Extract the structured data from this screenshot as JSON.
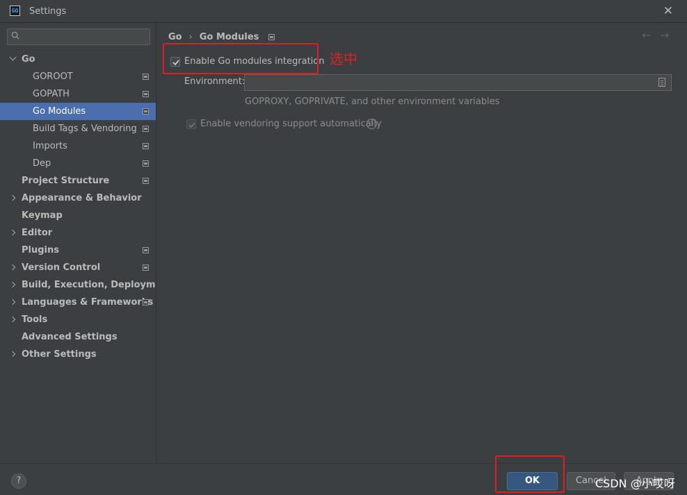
{
  "window": {
    "title": "Settings",
    "app_icon_text": "GO"
  },
  "search": {
    "placeholder": ""
  },
  "sidebar": {
    "items": [
      {
        "label": "Go",
        "level": 0,
        "expander": "down",
        "bold": true,
        "proj_icon": false,
        "selected": false
      },
      {
        "label": "GOROOT",
        "level": 1,
        "expander": "none",
        "bold": false,
        "proj_icon": true,
        "selected": false
      },
      {
        "label": "GOPATH",
        "level": 1,
        "expander": "none",
        "bold": false,
        "proj_icon": true,
        "selected": false
      },
      {
        "label": "Go Modules",
        "level": 1,
        "expander": "none",
        "bold": false,
        "proj_icon": true,
        "selected": true
      },
      {
        "label": "Build Tags & Vendoring",
        "level": 1,
        "expander": "none",
        "bold": false,
        "proj_icon": true,
        "selected": false
      },
      {
        "label": "Imports",
        "level": 1,
        "expander": "none",
        "bold": false,
        "proj_icon": true,
        "selected": false
      },
      {
        "label": "Dep",
        "level": 1,
        "expander": "none",
        "bold": false,
        "proj_icon": true,
        "selected": false
      },
      {
        "label": "Project Structure",
        "level": 0,
        "expander": "none",
        "bold": true,
        "proj_icon": true,
        "selected": false
      },
      {
        "label": "Appearance & Behavior",
        "level": 0,
        "expander": "right",
        "bold": true,
        "proj_icon": false,
        "selected": false
      },
      {
        "label": "Keymap",
        "level": 0,
        "expander": "none",
        "bold": true,
        "proj_icon": false,
        "selected": false
      },
      {
        "label": "Editor",
        "level": 0,
        "expander": "right",
        "bold": true,
        "proj_icon": false,
        "selected": false
      },
      {
        "label": "Plugins",
        "level": 0,
        "expander": "none",
        "bold": true,
        "proj_icon": true,
        "selected": false
      },
      {
        "label": "Version Control",
        "level": 0,
        "expander": "right",
        "bold": true,
        "proj_icon": true,
        "selected": false
      },
      {
        "label": "Build, Execution, Deployment",
        "level": 0,
        "expander": "right",
        "bold": true,
        "proj_icon": false,
        "selected": false
      },
      {
        "label": "Languages & Frameworks",
        "level": 0,
        "expander": "right",
        "bold": true,
        "proj_icon": true,
        "selected": false
      },
      {
        "label": "Tools",
        "level": 0,
        "expander": "right",
        "bold": true,
        "proj_icon": false,
        "selected": false
      },
      {
        "label": "Advanced Settings",
        "level": 0,
        "expander": "none",
        "bold": true,
        "proj_icon": false,
        "selected": false
      },
      {
        "label": "Other Settings",
        "level": 0,
        "expander": "right",
        "bold": true,
        "proj_icon": false,
        "selected": false
      }
    ]
  },
  "breadcrumb": {
    "parent": "Go",
    "separator": "›",
    "current": "Go Modules"
  },
  "nav": {
    "back": "←",
    "forward": "→"
  },
  "settings": {
    "enable_modules_label": "Enable Go modules integration",
    "enable_modules_checked": true,
    "environment_label": "Environment:",
    "environment_value": "",
    "environment_hint": "GOPROXY, GOPRIVATE, and other environment variables",
    "vendoring_label": "Enable vendoring support automatically",
    "vendoring_checked": true,
    "vendoring_enabled": false
  },
  "annotation": {
    "text": "选中",
    "color": "#e02020"
  },
  "footer": {
    "help_label": "?",
    "ok_label": "OK",
    "cancel_label": "Cancel",
    "apply_label": "Apply"
  },
  "watermark": "CSDN @小哎呀",
  "colors": {
    "background": "#3c3f41",
    "selection": "#4b6eaf",
    "primary_button": "#365880",
    "highlight": "#e02020"
  }
}
